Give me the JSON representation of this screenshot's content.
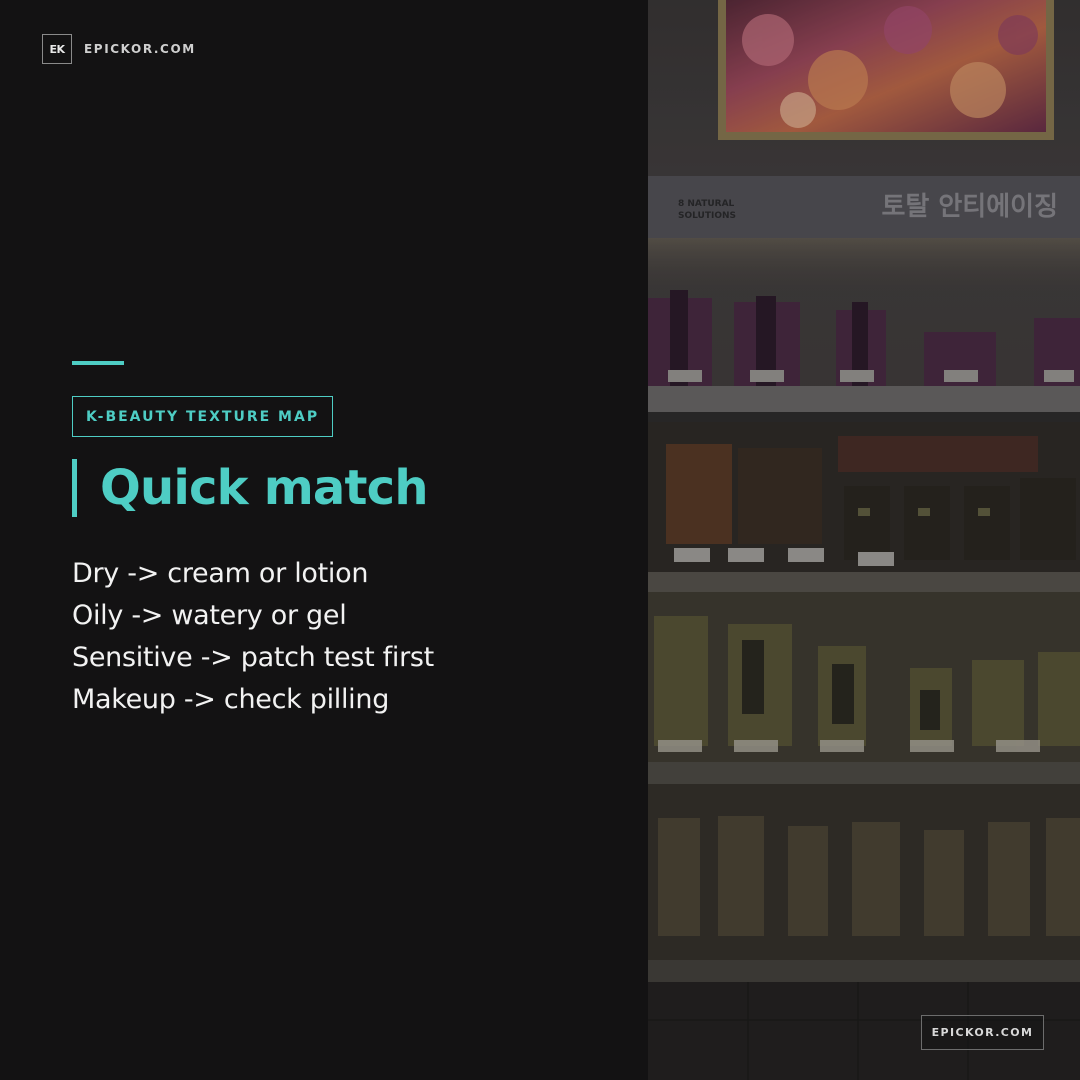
{
  "brand": {
    "mark": "EK",
    "site": "EPICKOR.COM"
  },
  "badge": "K-BEAUTY TEXTURE MAP",
  "title": "Quick match",
  "lines": [
    "Dry -> cream or lotion",
    "Oily -> watery or gel",
    "Sensitive -> patch test first",
    "Makeup -> check pilling"
  ],
  "photo": {
    "store_sign": "토탈 안티에이징",
    "brand_sign": "8 NATURAL SOLUTIONS"
  },
  "footer": "EPICKOR.COM",
  "colors": {
    "accent": "#4ecdc4",
    "background": "#131213",
    "text": "#f2f2f2"
  }
}
